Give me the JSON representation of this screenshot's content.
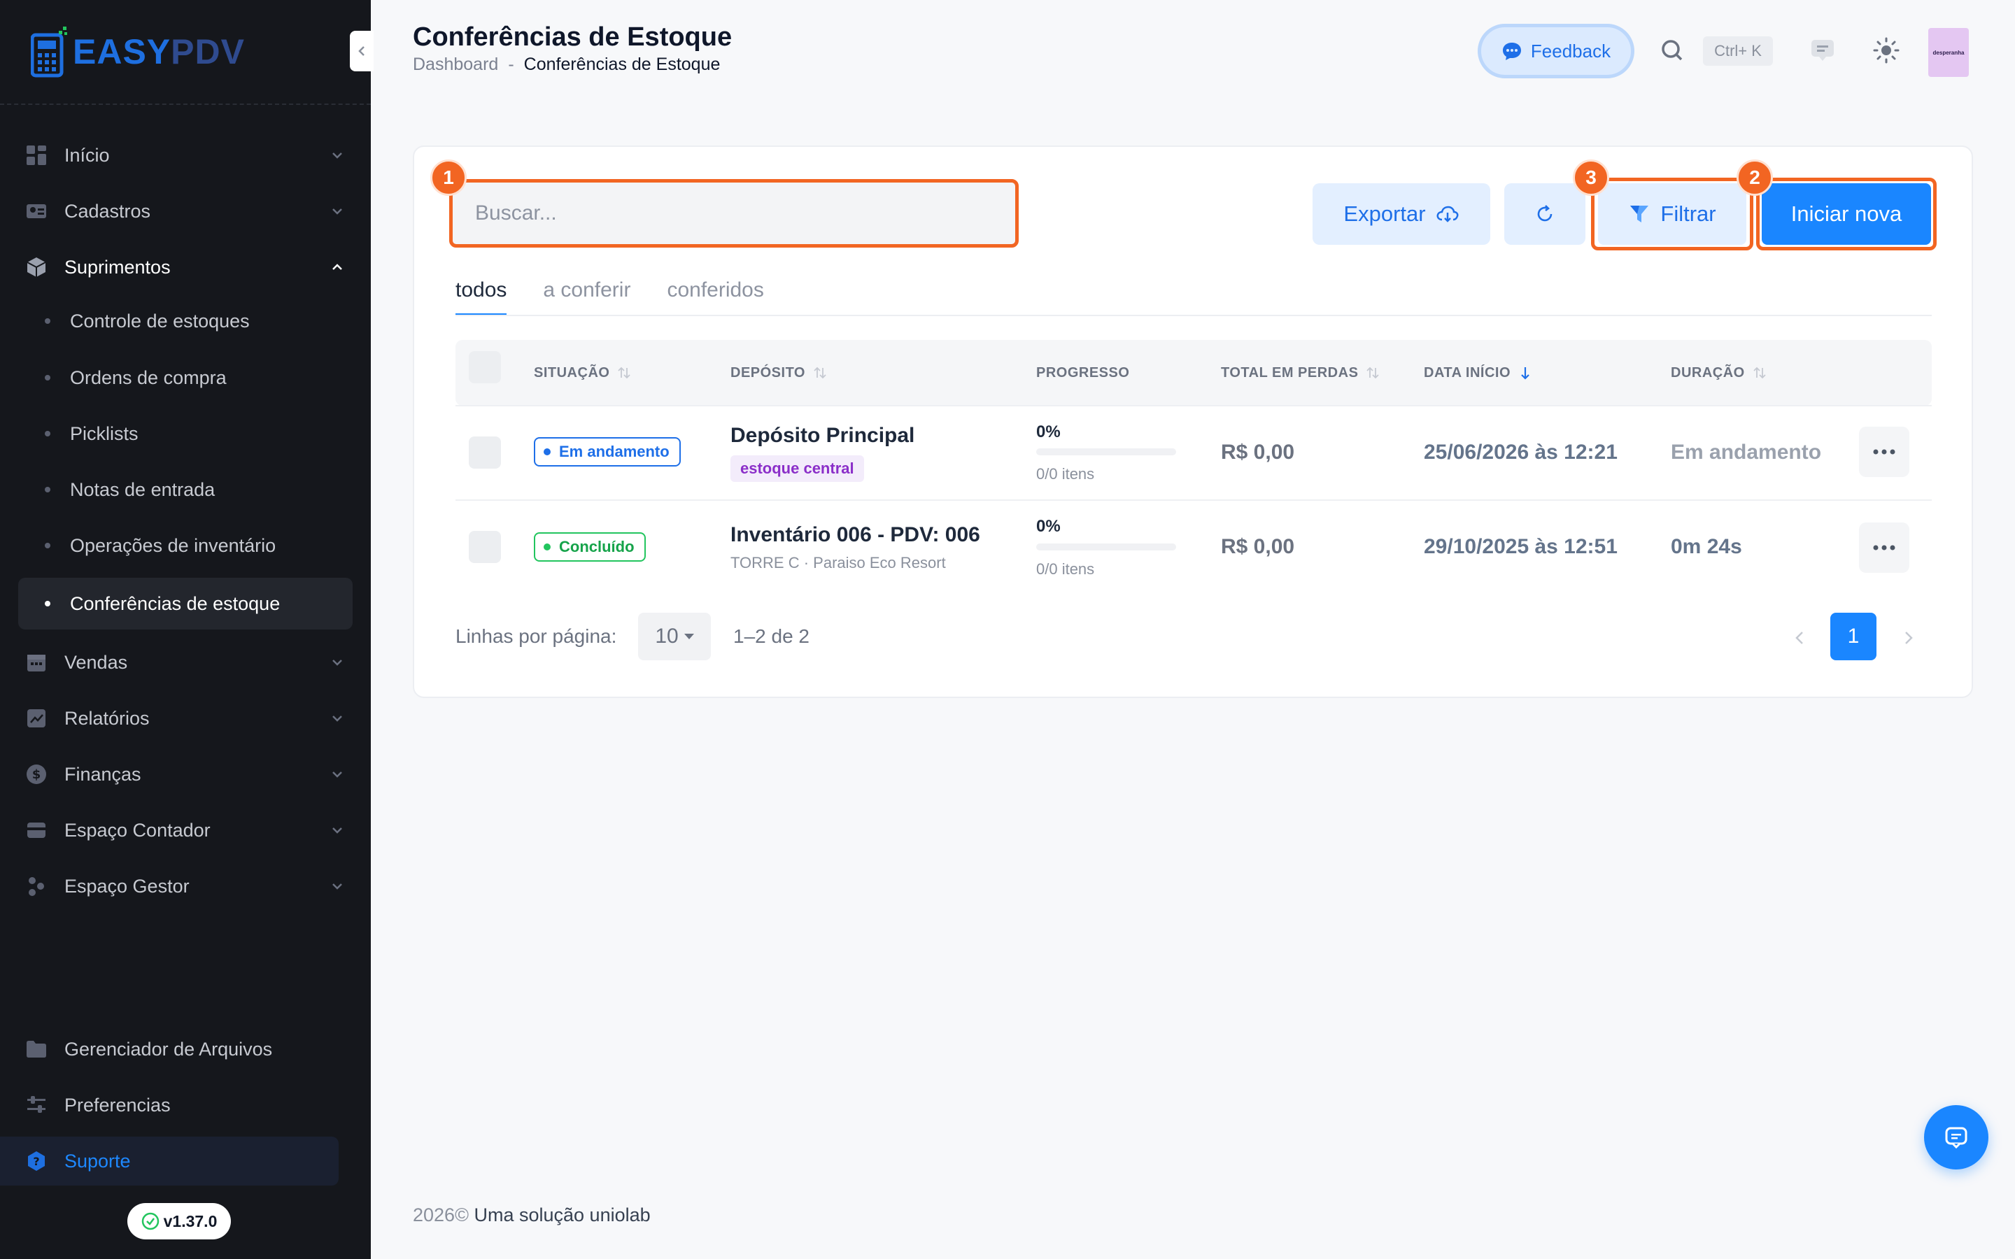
{
  "brand": {
    "easy": "EASY",
    "pdv": "PDV"
  },
  "sidebar": {
    "items": [
      {
        "label": "Início",
        "icon": "dashboard-icon"
      },
      {
        "label": "Cadastros",
        "icon": "id-card-icon"
      },
      {
        "label": "Suprimentos",
        "icon": "box-icon",
        "open": true
      },
      {
        "label": "Vendas",
        "icon": "calendar-icon"
      },
      {
        "label": "Relatórios",
        "icon": "chart-icon"
      },
      {
        "label": "Finanças",
        "icon": "dollar-icon"
      },
      {
        "label": "Espaço Contador",
        "icon": "wallet-icon"
      },
      {
        "label": "Espaço Gestor",
        "icon": "manager-icon"
      }
    ],
    "sub_items": [
      {
        "label": "Controle de estoques"
      },
      {
        "label": "Ordens de compra"
      },
      {
        "label": "Picklists"
      },
      {
        "label": "Notas de entrada"
      },
      {
        "label": "Operações de inventário"
      },
      {
        "label": "Conferências de estoque",
        "active": true
      }
    ],
    "bottom_items": [
      {
        "label": "Gerenciador de Arquivos",
        "icon": "folder-icon"
      },
      {
        "label": "Preferencias",
        "icon": "sliders-icon"
      },
      {
        "label": "Suporte",
        "icon": "help-icon"
      }
    ],
    "version": "v1.37.0"
  },
  "header": {
    "title": "Conferências de Estoque",
    "breadcrumb": {
      "home": "Dashboard",
      "separator": "-",
      "current": "Conferências de Estoque"
    },
    "feedback_label": "Feedback",
    "shortcut": "Ctrl+ K",
    "avatar_text": "desperanha"
  },
  "toolbar": {
    "search_placeholder": "Buscar...",
    "export_label": "Exportar",
    "filter_label": "Filtrar",
    "new_label": "Iniciar nova",
    "annotations": [
      "1",
      "2",
      "3"
    ]
  },
  "tabs": [
    {
      "label": "todos",
      "active": true
    },
    {
      "label": "a conferir"
    },
    {
      "label": "conferidos"
    }
  ],
  "table": {
    "headers": {
      "situacao": "SITUAÇÃO",
      "deposito": "DEPÓSITO",
      "progresso": "PROGRESSO",
      "total_perdas": "TOTAL EM PERDAS",
      "data_inicio": "DATA INÍCIO",
      "duracao": "DURAÇÃO"
    },
    "rows": [
      {
        "status": "Em andamento",
        "title": "Depósito Principal",
        "tag": "estoque central",
        "progress_pct": "0%",
        "progress_items": "0/0 itens",
        "losses": "R$ 0,00",
        "start": "25/06/2026 às 12:21",
        "duration": "Em andamento"
      },
      {
        "status": "Concluído",
        "title": "Inventário 006 - PDV: 006",
        "subtitle": "TORRE C · Paraiso Eco Resort",
        "progress_pct": "0%",
        "progress_items": "0/0 itens",
        "losses": "R$ 0,00",
        "start": "29/10/2025 às 12:51",
        "duration": "0m 24s"
      }
    ]
  },
  "pagination": {
    "rows_label": "Linhas por página:",
    "rows_value": "10",
    "range": "1–2 de 2",
    "current_page": "1"
  },
  "footer": {
    "year": "2026©",
    "text": "Uma solução uniolab"
  },
  "colors": {
    "accent": "#1a86ff",
    "annotation": "#f26522",
    "sidebar_bg": "#15171c"
  }
}
